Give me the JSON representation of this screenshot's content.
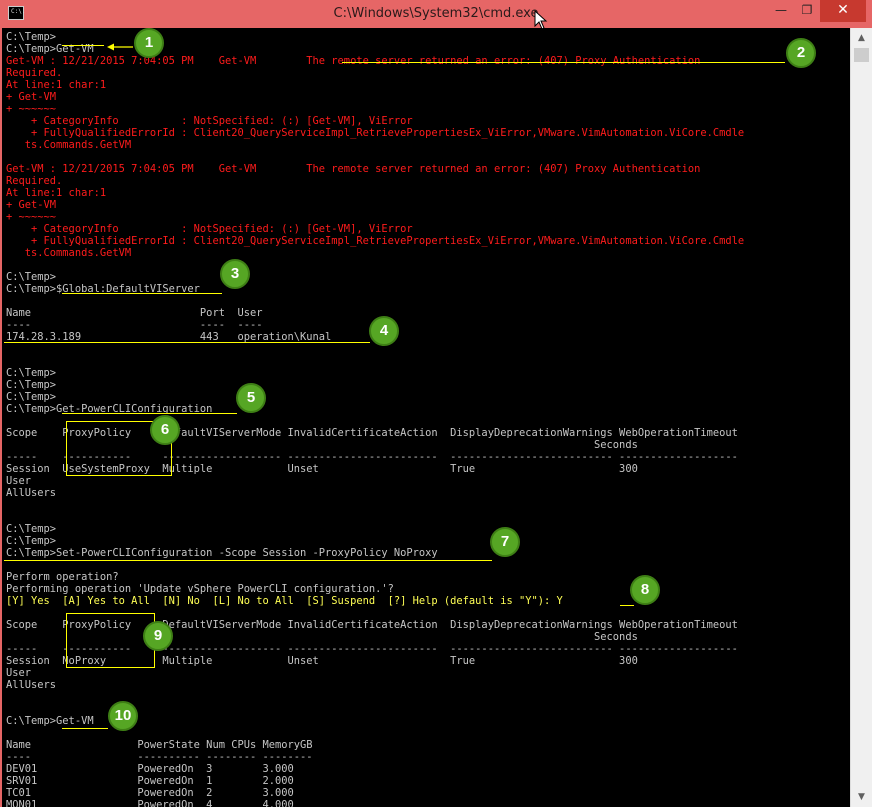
{
  "window": {
    "title": "C:\\Windows\\System32\\cmd.exe",
    "app_icon_text": "C:\\.",
    "controls": {
      "minimize": "—",
      "maximize": "❐",
      "close": "✕"
    }
  },
  "console": {
    "lines": [
      "C:\\Temp>",
      "C:\\Temp>Get-VM",
      "Get-VM : 12/21/2015 7:04:05 PM    Get-VM        The remote server returned an error: (407) Proxy Authentication",
      "Required.",
      "At line:1 char:1",
      "+ Get-VM",
      "+ ~~~~~~",
      "    + CategoryInfo          : NotSpecified: (:) [Get-VM], ViError",
      "    + FullyQualifiedErrorId : Client20_QueryServiceImpl_RetrievePropertiesEx_ViError,VMware.VimAutomation.ViCore.Cmdle",
      "   ts.Commands.GetVM",
      "",
      "Get-VM : 12/21/2015 7:04:05 PM    Get-VM        The remote server returned an error: (407) Proxy Authentication",
      "Required.",
      "At line:1 char:1",
      "+ Get-VM",
      "+ ~~~~~~",
      "    + CategoryInfo          : NotSpecified: (:) [Get-VM], ViError",
      "    + FullyQualifiedErrorId : Client20_QueryServiceImpl_RetrievePropertiesEx_ViError,VMware.VimAutomation.ViCore.Cmdle",
      "   ts.Commands.GetVM",
      "",
      "C:\\Temp>",
      "C:\\Temp>$Global:DefaultVIServer",
      "",
      "Name                           Port  User",
      "----                           ----  ----",
      "174.28.3.189                   443   operation\\Kunal",
      "",
      "",
      "C:\\Temp>",
      "C:\\Temp>",
      "C:\\Temp>",
      "C:\\Temp>Get-PowerCLIConfiguration",
      "",
      "Scope    ProxyPolicy     DefaultVIServerMode InvalidCertificateAction  DisplayDeprecationWarnings WebOperationTimeout",
      "                                                                                              Seconds",
      "-----    -----------     ------------------- ------------------------  -------------------------- -------------------",
      "Session  UseSystemProxy  Multiple            Unset                     True                       300",
      "User",
      "AllUsers",
      "",
      "",
      "C:\\Temp>",
      "C:\\Temp>",
      "C:\\Temp>Set-PowerCLIConfiguration -Scope Session -ProxyPolicy NoProxy",
      "",
      "Perform operation?",
      "Performing operation 'Update vSphere PowerCLI configuration.'?",
      "[Y] Yes  [A] Yes to All  [N] No  [L] No to All  [S] Suspend  [?] Help (default is \"Y\"): Y",
      "",
      "Scope    ProxyPolicy     DefaultVIServerMode InvalidCertificateAction  DisplayDeprecationWarnings WebOperationTimeout",
      "                                                                                              Seconds",
      "-----    -----------     ------------------- ------------------------  -------------------------- -------------------",
      "Session  NoProxy         Multiple            Unset                     True                       300",
      "User",
      "AllUsers",
      "",
      "",
      "C:\\Temp>Get-VM",
      "",
      "Name                 PowerState Num CPUs MemoryGB",
      "----                 ---------- -------- --------",
      "DEV01                PoweredOn  3        3.000",
      "SRV01                PoweredOn  1        2.000",
      "TC01                 PoweredOn  2        3.000",
      "MON01                PoweredOn  4        4.000"
    ],
    "styles": {
      "2": "err",
      "3": "err",
      "4": "err",
      "5": "err",
      "6": "err",
      "7": "err",
      "8": "err",
      "9": "err",
      "11": "err",
      "12": "err",
      "13": "err",
      "14": "err",
      "15": "err",
      "16": "err",
      "17": "err",
      "18": "err",
      "47": "yel"
    },
    "colors": {
      "text": "#c6c6c6",
      "error": "#ff1c1c",
      "prompt_highlight": "#ffff55",
      "annotation": "#ffff00"
    }
  },
  "annotations": {
    "badges": [
      "1",
      "2",
      "3",
      "4",
      "5",
      "6",
      "7",
      "8",
      "9",
      "10"
    ],
    "badge_color": "#56a624"
  }
}
